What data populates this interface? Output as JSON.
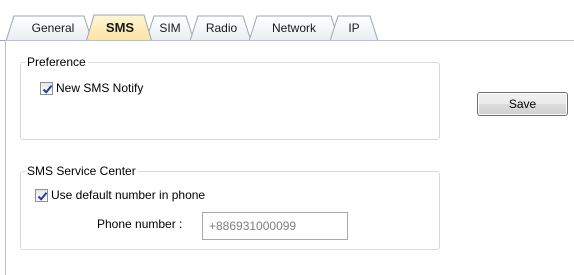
{
  "tabs": [
    {
      "label": "General",
      "active": false
    },
    {
      "label": "SMS",
      "active": true
    },
    {
      "label": "SIM",
      "active": false
    },
    {
      "label": "Radio",
      "active": false
    },
    {
      "label": "Network",
      "active": false
    },
    {
      "label": "IP",
      "active": false
    }
  ],
  "preference": {
    "legend": "Preference",
    "new_sms_notify": {
      "label": "New SMS Notify",
      "checked": true
    }
  },
  "sms_service_center": {
    "legend": "SMS Service Center",
    "use_default": {
      "label": "Use default number in phone",
      "checked": true
    },
    "phone_number_label": "Phone number :",
    "phone_number_value": "+886931000099"
  },
  "save_label": "Save",
  "colors": {
    "active_tab_bg": "#fbe8a8",
    "tab_border": "#9aa7b5",
    "check_mark": "#1f3f9a"
  }
}
